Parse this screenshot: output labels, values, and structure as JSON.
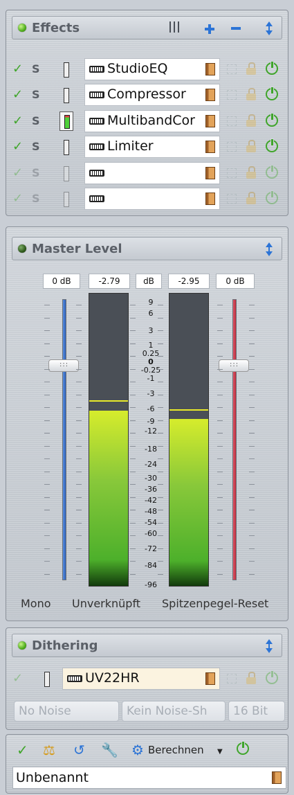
{
  "effects": {
    "title": "Effects",
    "slots": [
      {
        "name": "StudioEQ",
        "s": "S",
        "active": false,
        "enabled": true
      },
      {
        "name": "Compressor",
        "s": "S",
        "active": false,
        "enabled": true
      },
      {
        "name": "MultibandCor",
        "s": "S",
        "active": true,
        "enabled": true
      },
      {
        "name": "Limiter",
        "s": "S",
        "active": false,
        "enabled": true
      },
      {
        "name": "",
        "s": "S",
        "active": false,
        "enabled": false
      },
      {
        "name": "",
        "s": "S",
        "active": false,
        "enabled": false
      }
    ],
    "icons": [
      "columns-icon",
      "plus-icon",
      "minus-icon",
      "up-down-arrow-icon"
    ]
  },
  "master": {
    "title": "Master Level",
    "left_fader_value": "0 dB",
    "left_peak": "-2.79",
    "unit": "dB",
    "right_peak": "-2.95",
    "right_fader_value": "0 dB",
    "scale": [
      "9",
      "6",
      "3",
      "1",
      "0.25",
      "0",
      "-0.25",
      "-1",
      "-3",
      "-6",
      "-9",
      "-12",
      "-18",
      "-24",
      "-30",
      "-36",
      "-42",
      "-48",
      "-54",
      "-60",
      "-72",
      "-84",
      "-96"
    ],
    "left_level_fraction": 0.6,
    "left_peak_fraction": 0.63,
    "right_level_fraction": 0.57,
    "right_peak_fraction": 0.6,
    "mono_label": "Mono",
    "link_label": "Unverknüpft",
    "reset_label": "Spitzenpegel-Reset"
  },
  "dithering": {
    "title": "Dithering",
    "plugin": "UV22HR",
    "noise": "No Noise",
    "noise_shaping": "Kein Noise-Sh",
    "bits": "16 Bit"
  },
  "toolbar": {
    "render_label": "Berechnen",
    "preset_name": "Unbenannt"
  },
  "colors": {
    "check": "#3fa52a",
    "accent_blue": "#2c74d6",
    "meter_yellow": "#d6ec2c",
    "meter_green": "#4db02b"
  }
}
